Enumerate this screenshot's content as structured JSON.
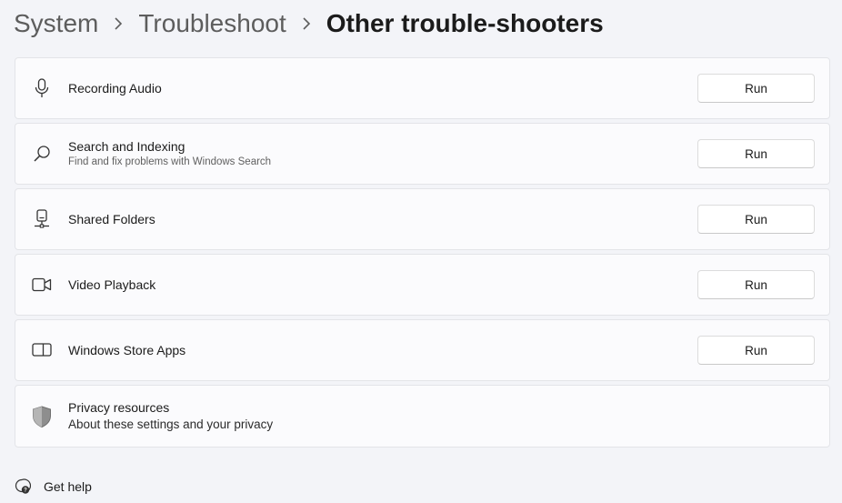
{
  "breadcrumb": {
    "items": [
      "System",
      "Troubleshoot"
    ],
    "current": "Other trouble-shooters"
  },
  "troubleshooters": [
    {
      "title": "Recording Audio",
      "subtitle": "",
      "icon": "microphone-icon",
      "button": "Run"
    },
    {
      "title": "Search and Indexing",
      "subtitle": "Find and fix problems with Windows Search",
      "icon": "search-icon",
      "button": "Run"
    },
    {
      "title": "Shared Folders",
      "subtitle": "",
      "icon": "network-drive-icon",
      "button": "Run"
    },
    {
      "title": "Video Playback",
      "subtitle": "",
      "icon": "video-camera-icon",
      "button": "Run"
    },
    {
      "title": "Windows Store Apps",
      "subtitle": "",
      "icon": "store-apps-icon",
      "button": "Run"
    }
  ],
  "privacy": {
    "title": "Privacy resources",
    "link": "About these settings and your privacy",
    "icon": "shield-icon"
  },
  "help": {
    "label": "Get help",
    "icon": "help-chat-icon"
  }
}
